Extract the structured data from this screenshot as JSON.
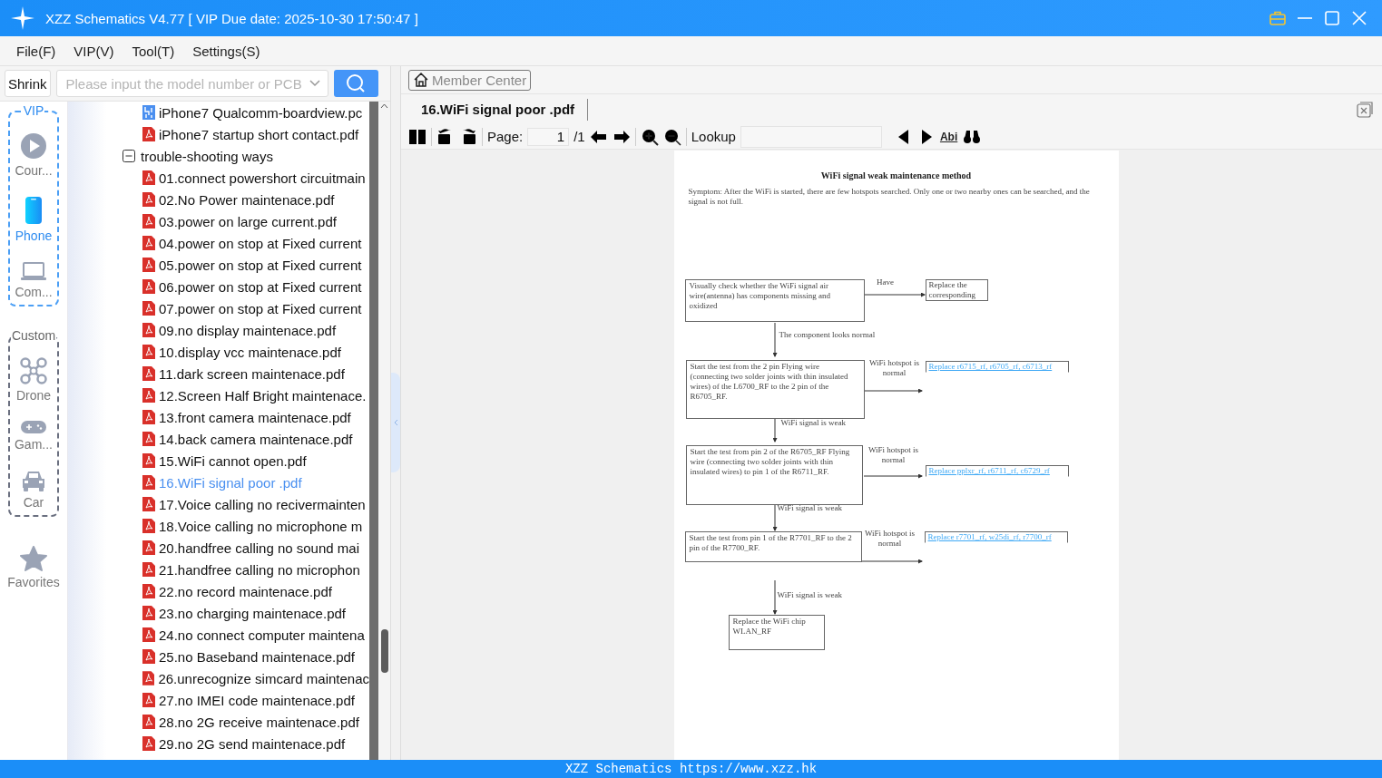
{
  "window": {
    "title": "XZZ Schematics V4.77 [ VIP Due date: 2025-10-30 17:50:47 ]"
  },
  "menu": [
    "File(F)",
    "VIP(V)",
    "Tool(T)",
    "Settings(S)"
  ],
  "search": {
    "shrink": "Shrink",
    "placeholder": "Please input the model number or PCB"
  },
  "sidebar": {
    "groups": [
      {
        "title": "VIP",
        "kind": "vip",
        "items": [
          {
            "label": "Cour...",
            "selected": false
          },
          {
            "label": "Phone",
            "selected": true
          },
          {
            "label": "Com...",
            "selected": false
          }
        ]
      },
      {
        "title": "Custom",
        "kind": "custom",
        "items": [
          {
            "label": "Drone",
            "selected": false
          },
          {
            "label": "Gam...",
            "selected": false
          },
          {
            "label": "Car",
            "selected": false
          }
        ]
      }
    ],
    "favorites": "Favorites"
  },
  "tree": {
    "items": [
      {
        "kind": "boardview",
        "label": "iPhone7 Qualcomm-boardview.pc",
        "selected": false
      },
      {
        "kind": "pdf",
        "label": "iPhone7 startup short contact.pdf",
        "selected": false
      },
      {
        "kind": "folder",
        "label": "trouble-shooting ways",
        "expanded": true,
        "children": [
          {
            "kind": "pdf",
            "label": "01.connect powershort circuitmain",
            "selected": false
          },
          {
            "kind": "pdf",
            "label": "02.No Power maintenace.pdf",
            "selected": false
          },
          {
            "kind": "pdf",
            "label": "03.power on large current.pdf",
            "selected": false
          },
          {
            "kind": "pdf",
            "label": "04.power on stop at Fixed current",
            "selected": false
          },
          {
            "kind": "pdf",
            "label": "05.power on stop at Fixed current",
            "selected": false
          },
          {
            "kind": "pdf",
            "label": "06.power on stop at Fixed current",
            "selected": false
          },
          {
            "kind": "pdf",
            "label": "07.power on stop at Fixed current",
            "selected": false
          },
          {
            "kind": "pdf",
            "label": "09.no display maintenace.pdf",
            "selected": false
          },
          {
            "kind": "pdf",
            "label": "10.display vcc maintenace.pdf",
            "selected": false
          },
          {
            "kind": "pdf",
            "label": "11.dark screen maintenace.pdf",
            "selected": false
          },
          {
            "kind": "pdf",
            "label": "12.Screen Half Bright maintenace.",
            "selected": false
          },
          {
            "kind": "pdf",
            "label": "13.front camera maintenace.pdf",
            "selected": false
          },
          {
            "kind": "pdf",
            "label": "14.back camera maintenace.pdf",
            "selected": false
          },
          {
            "kind": "pdf",
            "label": "15.WiFi cannot open.pdf",
            "selected": false
          },
          {
            "kind": "pdf",
            "label": "16.WiFi signal poor .pdf",
            "selected": true
          },
          {
            "kind": "pdf",
            "label": "17.Voice calling no recivermainten",
            "selected": false
          },
          {
            "kind": "pdf",
            "label": "18.Voice calling no microphone m",
            "selected": false
          },
          {
            "kind": "pdf",
            "label": "20.handfree calling no sound mai",
            "selected": false
          },
          {
            "kind": "pdf",
            "label": "21.handfree calling no microphon",
            "selected": false
          },
          {
            "kind": "pdf",
            "label": "22.no record maintenace.pdf",
            "selected": false
          },
          {
            "kind": "pdf",
            "label": "23.no charging maintenace.pdf",
            "selected": false
          },
          {
            "kind": "pdf",
            "label": "24.no connect computer maintena",
            "selected": false
          },
          {
            "kind": "pdf",
            "label": "25.no Baseband maintenace.pdf",
            "selected": false
          },
          {
            "kind": "pdf",
            "label": "26.unrecognize simcard maintenac",
            "selected": false
          },
          {
            "kind": "pdf",
            "label": "27.no IMEI code maintenace.pdf",
            "selected": false
          },
          {
            "kind": "pdf",
            "label": "28.no 2G receive maintenace.pdf",
            "selected": false
          },
          {
            "kind": "pdf",
            "label": "29.no 2G send maintenace.pdf",
            "selected": false
          }
        ]
      }
    ]
  },
  "viewer": {
    "member_center": "Member Center",
    "tab": "16.WiFi signal poor .pdf",
    "toolbar": {
      "page_label": "Page:",
      "page_value": "1",
      "page_total": "/1",
      "lookup_label": "Lookup",
      "abi": "Abi"
    },
    "document": {
      "title": "WiFi signal weak maintenance method",
      "symptom": "Symptom: After the WiFi is started, there are few hotspots searched. Only one or two nearby ones can be searched, and the signal is not full.",
      "steps": [
        "Visually check whether the WiFi signal air wire(antenna) has components missing and oxidized",
        "Start the test from the 2 pin Flying wire (connecting two solder joints with thin insulated wires) of the L6700_RF to the 2 pin of the R6705_RF.",
        "Start the test from pin 2 of the R6705_RF Flying wire (connecting two solder joints with thin insulated wires) to pin 1 of the R6711_RF.",
        "Start the test from pin 1 of the R7701_RF to the 2 pin of the R7700_RF."
      ],
      "results": [
        "Replace the corresponding",
        "Replace r6715_rf, r6705_rf, c6713_rf",
        "Replace pplxr_rf, r6711_rf, c6729_rf",
        "Replace r7701_rf, w25di_rf, r7700_rf"
      ],
      "branch_labels": [
        "Have",
        "WiFi hotspot is normal",
        "WiFi hotspot is normal",
        "WiFi hotspot is normal"
      ],
      "down_labels": [
        "The component looks normal",
        "WiFi signal is weak",
        "WiFi signal is weak",
        "WiFi signal is weak"
      ],
      "final": "Replace the WiFi chip WLAN_RF"
    }
  },
  "status_bar": "XZZ Schematics https://www.xzz.hk"
}
